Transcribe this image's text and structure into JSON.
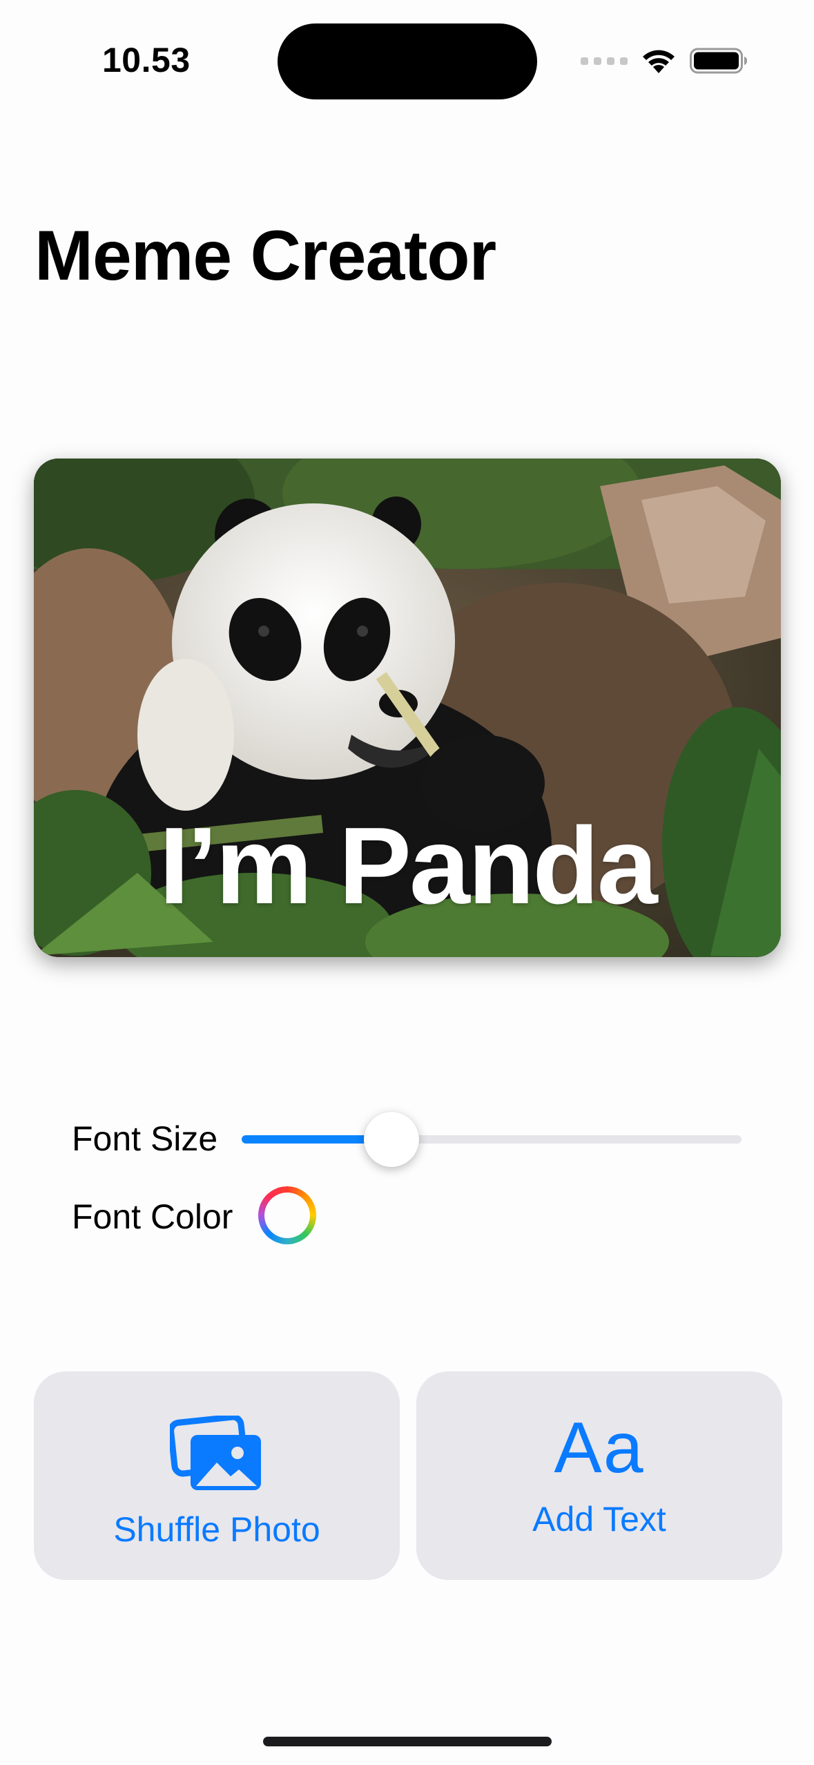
{
  "status_bar": {
    "time": "10.53",
    "icons": [
      "cellular-signal-icon",
      "wifi-icon",
      "battery-icon"
    ]
  },
  "header": {
    "title": "Meme Creator"
  },
  "meme": {
    "caption": "I’m Panda",
    "caption_color": "#ffffff",
    "photo": "panda-eating-bamboo-photo"
  },
  "controls": {
    "font_size_label": "Font Size",
    "font_size_value": 0.3,
    "font_color_label": "Font Color"
  },
  "actions": {
    "shuffle_label": "Shuffle Photo",
    "shuffle_icon": "photo-stack-icon",
    "add_text_label": "Add Text",
    "add_text_icon": "Aa"
  },
  "colors": {
    "accent": "#0a7aff",
    "button_bg": "#e7e7ec"
  }
}
